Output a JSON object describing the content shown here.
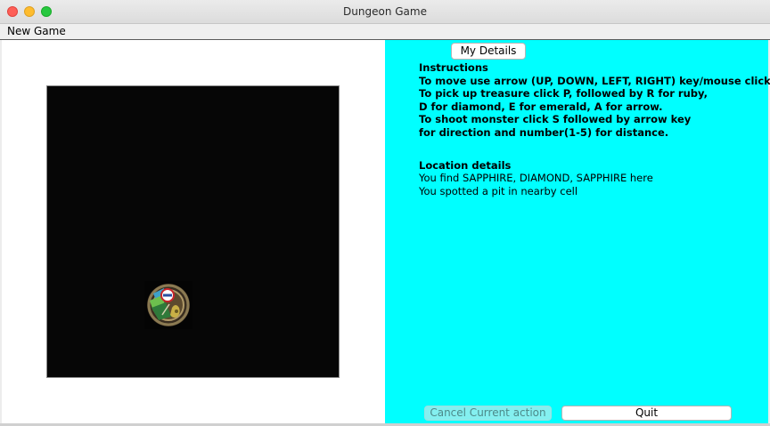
{
  "window": {
    "title": "Dungeon Game"
  },
  "menubar": {
    "items": [
      "New Game"
    ]
  },
  "dungeon": {
    "player_icon": "player-character-icon",
    "board_color": "#060606"
  },
  "details_button": "My Details",
  "instructions": {
    "heading": "Instructions",
    "lines": [
      "To move use arrow (UP, DOWN, LEFT, RIGHT) key/mouse click.",
      "To pick up treasure click P, followed by R for ruby,",
      "D for diamond, E for emerald, A for arrow.",
      "To shoot monster click S followed by arrow key",
      "for direction and number(1-5) for distance."
    ]
  },
  "location": {
    "heading": "Location details",
    "lines": [
      "You find SAPPHIRE, DIAMOND, SAPPHIRE here",
      "You spotted a pit in nearby cell"
    ]
  },
  "actions": {
    "cancel_label": "Cancel Current action",
    "quit_label": "Quit"
  },
  "colors": {
    "info_panel_bg": "#00ffff",
    "board_panel_bg": "#ffffff"
  }
}
